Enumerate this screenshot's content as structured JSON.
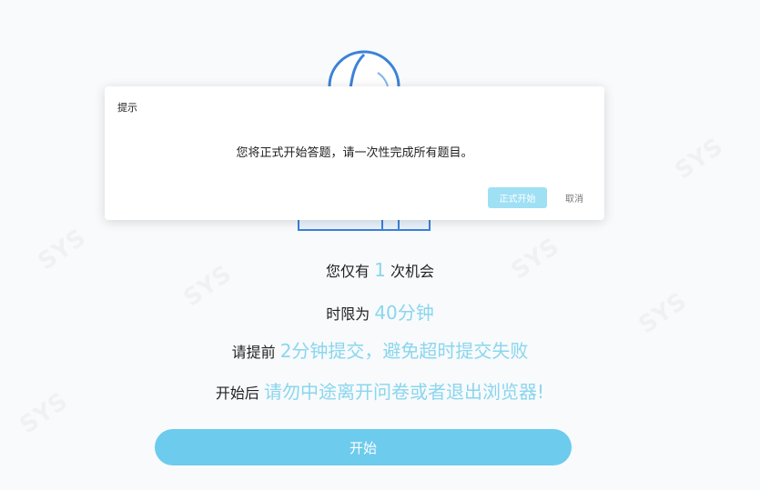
{
  "info": {
    "line1": {
      "pre": "您仅有",
      "hl": "1",
      "post": "次机会"
    },
    "line2": {
      "pre": "时限为",
      "hl": "40分钟"
    },
    "line3": {
      "pre": "请提前",
      "hl": "2分钟提交，避免超时提交失败"
    },
    "line4": {
      "pre": "开始后",
      "hl": "请勿中途离开问卷或者退出浏览器!"
    }
  },
  "start_button": {
    "label": "开始"
  },
  "dialog": {
    "title": "提示",
    "message": "您将正式开始答题，请一次性完成所有题目。",
    "confirm_label": "正式开始",
    "cancel_label": "取消"
  },
  "colors": {
    "accent": "#6dcbed",
    "highlight_text": "#8ad6ee",
    "confirm_button": "#9fe0f5"
  }
}
